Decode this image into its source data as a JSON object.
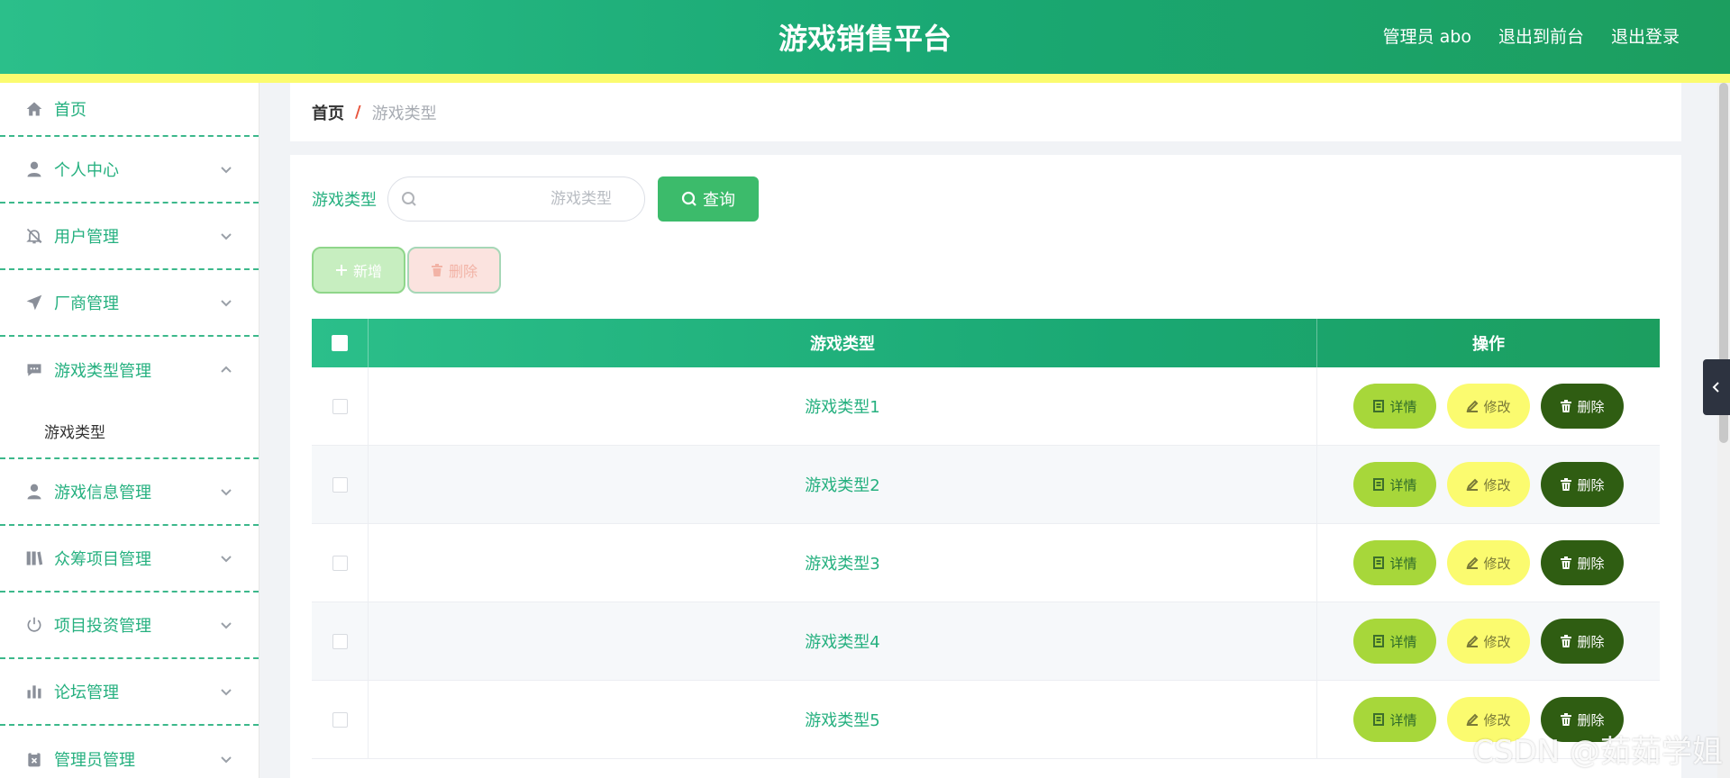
{
  "header": {
    "title": "游戏销售平台",
    "admin_label": "管理员 abo",
    "to_front": "退出到前台",
    "logout": "退出登录"
  },
  "sidebar": {
    "items": [
      {
        "label": "首页",
        "icon": "home-icon"
      },
      {
        "label": "个人中心",
        "icon": "user-icon"
      },
      {
        "label": "用户管理",
        "icon": "bell-off-icon"
      },
      {
        "label": "厂商管理",
        "icon": "send-icon"
      },
      {
        "label": "游戏类型管理",
        "icon": "chat-icon",
        "open": true,
        "sub": [
          "游戏类型"
        ]
      },
      {
        "label": "游戏信息管理",
        "icon": "user-icon"
      },
      {
        "label": "众筹项目管理",
        "icon": "library-icon"
      },
      {
        "label": "项目投资管理",
        "icon": "power-icon"
      },
      {
        "label": "论坛管理",
        "icon": "bar-chart-icon"
      },
      {
        "label": "管理员管理",
        "icon": "clipboard-icon"
      }
    ]
  },
  "breadcrumb": {
    "home": "首页",
    "separator": "/",
    "current": "游戏类型"
  },
  "search": {
    "label": "游戏类型",
    "placeholder": "游戏类型",
    "button": "查询"
  },
  "actions": {
    "add": "新增",
    "delete": "删除"
  },
  "table": {
    "columns": [
      "游戏类型",
      "操作"
    ],
    "rows": [
      "游戏类型1",
      "游戏类型2",
      "游戏类型3",
      "游戏类型4",
      "游戏类型5"
    ],
    "op_detail": "详情",
    "op_edit": "修改",
    "op_delete": "删除"
  },
  "watermark": "CSDN @茹茹学姐",
  "colors": {
    "brand_green": "#1aa873",
    "stripe_yellow": "#fbfb6f",
    "detail_btn": "#a7d73a",
    "edit_btn": "#fbfb6f",
    "delete_btn": "#2f5d12"
  }
}
